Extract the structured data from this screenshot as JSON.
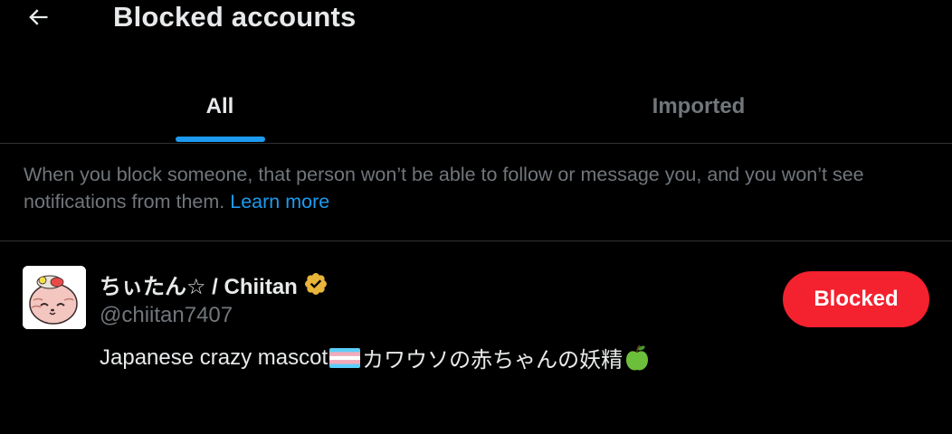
{
  "header": {
    "title": "Blocked accounts",
    "back_icon": "arrow-left-icon"
  },
  "tabs": [
    {
      "label": "All",
      "selected": true
    },
    {
      "label": "Imported",
      "selected": false
    }
  ],
  "info": {
    "text": "When you block someone, that person won’t be able to follow or message you, and you won’t see notifications from them.",
    "link": "Learn more"
  },
  "blocked_users": [
    {
      "display_name": "ちぃたん☆ / Chiitan",
      "verified": true,
      "verified_color": "#e8b43a",
      "handle": "@chiitan7407",
      "bio_before": "Japanese crazy mascot",
      "bio_flag_icon": "transgender-flag-icon",
      "bio_after": "カワウソの赤ちゃんの妖精",
      "bio_end_icon": "green-apple-icon",
      "button_label": "Blocked",
      "button_color": "#f4212e"
    }
  ],
  "colors": {
    "background": "#000000",
    "primary_text": "#e7e9ea",
    "secondary_text": "#71767b",
    "accent": "#1d9bf0",
    "divider": "#2f3336"
  }
}
